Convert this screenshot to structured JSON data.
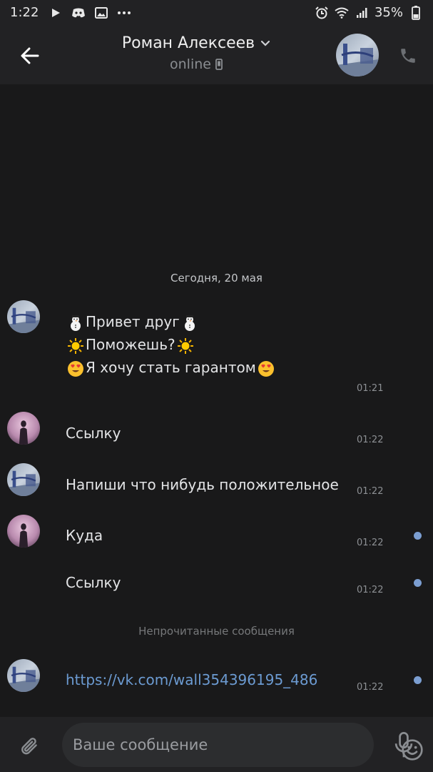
{
  "status_bar": {
    "time": "1:22",
    "battery": "35%",
    "left_icons": [
      "play-icon",
      "discord-icon",
      "image-icon",
      "more-dots-icon"
    ],
    "right_icons": [
      "alarm-icon",
      "wifi-icon",
      "signal-icon",
      "battery-icon"
    ]
  },
  "header": {
    "title": "Роман Алексеев",
    "status": "online",
    "icons": [
      "back-arrow-icon",
      "chevron-down-icon",
      "mobile-icon",
      "phone-icon"
    ]
  },
  "feed": {
    "date_separator": "Сегодня, 20 мая",
    "unread_separator": "Непрочитанные сообщения",
    "messages": [
      {
        "lines": [
          "Привет друг",
          "Поможешь?",
          "Я хочу стать гарантом"
        ],
        "emoji": [
          "snowman",
          "sun",
          "heart-eyes"
        ],
        "time": "01:21",
        "sender": "Роман Алексеев",
        "unread": false
      },
      {
        "text": "Ссылку",
        "time": "01:22",
        "sender": "me",
        "unread": false
      },
      {
        "text": "Напиши что нибудь положительное",
        "time": "01:22",
        "sender": "Роман Алексеев",
        "unread": false
      },
      {
        "text": "Куда",
        "time": "01:22",
        "sender": "me",
        "unread": true
      },
      {
        "text": "Ссылку",
        "time": "01:22",
        "sender": "me",
        "unread": true
      },
      {
        "text": "https://vk.com/wall354396195_486",
        "time": "01:22",
        "sender": "Роман Алексеев",
        "unread": true,
        "is_link": true
      }
    ]
  },
  "composer": {
    "placeholder": "Ваше сообщение",
    "icons": [
      "paperclip-icon",
      "smiley-icon",
      "microphone-icon"
    ]
  },
  "colors": {
    "background": "#19191a",
    "bar": "#222224",
    "link": "#6c9bd2",
    "unread_dot": "#7b9ed1"
  }
}
